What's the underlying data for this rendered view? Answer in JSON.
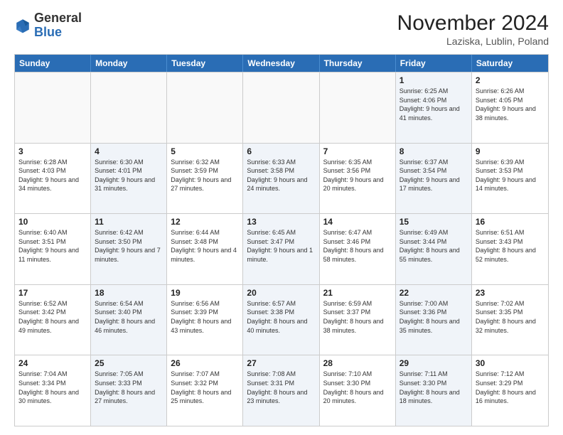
{
  "header": {
    "logo_general": "General",
    "logo_blue": "Blue",
    "month_title": "November 2024",
    "location": "Laziska, Lublin, Poland"
  },
  "days_of_week": [
    "Sunday",
    "Monday",
    "Tuesday",
    "Wednesday",
    "Thursday",
    "Friday",
    "Saturday"
  ],
  "weeks": [
    [
      {
        "day": "",
        "detail": ""
      },
      {
        "day": "",
        "detail": ""
      },
      {
        "day": "",
        "detail": ""
      },
      {
        "day": "",
        "detail": ""
      },
      {
        "day": "",
        "detail": ""
      },
      {
        "day": "1",
        "detail": "Sunrise: 6:25 AM\nSunset: 4:06 PM\nDaylight: 9 hours and 41 minutes."
      },
      {
        "day": "2",
        "detail": "Sunrise: 6:26 AM\nSunset: 4:05 PM\nDaylight: 9 hours and 38 minutes."
      }
    ],
    [
      {
        "day": "3",
        "detail": "Sunrise: 6:28 AM\nSunset: 4:03 PM\nDaylight: 9 hours and 34 minutes."
      },
      {
        "day": "4",
        "detail": "Sunrise: 6:30 AM\nSunset: 4:01 PM\nDaylight: 9 hours and 31 minutes."
      },
      {
        "day": "5",
        "detail": "Sunrise: 6:32 AM\nSunset: 3:59 PM\nDaylight: 9 hours and 27 minutes."
      },
      {
        "day": "6",
        "detail": "Sunrise: 6:33 AM\nSunset: 3:58 PM\nDaylight: 9 hours and 24 minutes."
      },
      {
        "day": "7",
        "detail": "Sunrise: 6:35 AM\nSunset: 3:56 PM\nDaylight: 9 hours and 20 minutes."
      },
      {
        "day": "8",
        "detail": "Sunrise: 6:37 AM\nSunset: 3:54 PM\nDaylight: 9 hours and 17 minutes."
      },
      {
        "day": "9",
        "detail": "Sunrise: 6:39 AM\nSunset: 3:53 PM\nDaylight: 9 hours and 14 minutes."
      }
    ],
    [
      {
        "day": "10",
        "detail": "Sunrise: 6:40 AM\nSunset: 3:51 PM\nDaylight: 9 hours and 11 minutes."
      },
      {
        "day": "11",
        "detail": "Sunrise: 6:42 AM\nSunset: 3:50 PM\nDaylight: 9 hours and 7 minutes."
      },
      {
        "day": "12",
        "detail": "Sunrise: 6:44 AM\nSunset: 3:48 PM\nDaylight: 9 hours and 4 minutes."
      },
      {
        "day": "13",
        "detail": "Sunrise: 6:45 AM\nSunset: 3:47 PM\nDaylight: 9 hours and 1 minute."
      },
      {
        "day": "14",
        "detail": "Sunrise: 6:47 AM\nSunset: 3:46 PM\nDaylight: 8 hours and 58 minutes."
      },
      {
        "day": "15",
        "detail": "Sunrise: 6:49 AM\nSunset: 3:44 PM\nDaylight: 8 hours and 55 minutes."
      },
      {
        "day": "16",
        "detail": "Sunrise: 6:51 AM\nSunset: 3:43 PM\nDaylight: 8 hours and 52 minutes."
      }
    ],
    [
      {
        "day": "17",
        "detail": "Sunrise: 6:52 AM\nSunset: 3:42 PM\nDaylight: 8 hours and 49 minutes."
      },
      {
        "day": "18",
        "detail": "Sunrise: 6:54 AM\nSunset: 3:40 PM\nDaylight: 8 hours and 46 minutes."
      },
      {
        "day": "19",
        "detail": "Sunrise: 6:56 AM\nSunset: 3:39 PM\nDaylight: 8 hours and 43 minutes."
      },
      {
        "day": "20",
        "detail": "Sunrise: 6:57 AM\nSunset: 3:38 PM\nDaylight: 8 hours and 40 minutes."
      },
      {
        "day": "21",
        "detail": "Sunrise: 6:59 AM\nSunset: 3:37 PM\nDaylight: 8 hours and 38 minutes."
      },
      {
        "day": "22",
        "detail": "Sunrise: 7:00 AM\nSunset: 3:36 PM\nDaylight: 8 hours and 35 minutes."
      },
      {
        "day": "23",
        "detail": "Sunrise: 7:02 AM\nSunset: 3:35 PM\nDaylight: 8 hours and 32 minutes."
      }
    ],
    [
      {
        "day": "24",
        "detail": "Sunrise: 7:04 AM\nSunset: 3:34 PM\nDaylight: 8 hours and 30 minutes."
      },
      {
        "day": "25",
        "detail": "Sunrise: 7:05 AM\nSunset: 3:33 PM\nDaylight: 8 hours and 27 minutes."
      },
      {
        "day": "26",
        "detail": "Sunrise: 7:07 AM\nSunset: 3:32 PM\nDaylight: 8 hours and 25 minutes."
      },
      {
        "day": "27",
        "detail": "Sunrise: 7:08 AM\nSunset: 3:31 PM\nDaylight: 8 hours and 23 minutes."
      },
      {
        "day": "28",
        "detail": "Sunrise: 7:10 AM\nSunset: 3:30 PM\nDaylight: 8 hours and 20 minutes."
      },
      {
        "day": "29",
        "detail": "Sunrise: 7:11 AM\nSunset: 3:30 PM\nDaylight: 8 hours and 18 minutes."
      },
      {
        "day": "30",
        "detail": "Sunrise: 7:12 AM\nSunset: 3:29 PM\nDaylight: 8 hours and 16 minutes."
      }
    ]
  ]
}
